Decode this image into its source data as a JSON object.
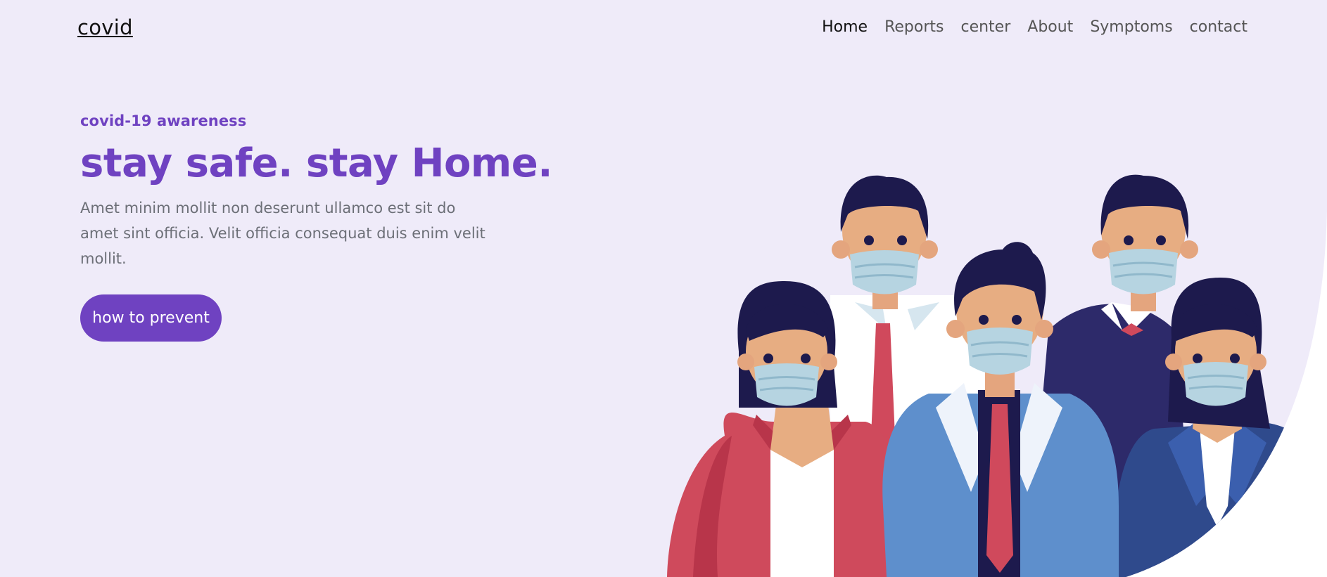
{
  "brand": {
    "name": "covid"
  },
  "nav": {
    "items": [
      {
        "label": "Home",
        "active": true
      },
      {
        "label": "Reports",
        "active": false
      },
      {
        "label": "center",
        "active": false
      },
      {
        "label": "About",
        "active": false
      },
      {
        "label": "Symptoms",
        "active": false
      },
      {
        "label": "contact",
        "active": false
      }
    ]
  },
  "hero": {
    "eyebrow": "covid-19 awareness",
    "headline": "stay safe. stay Home.",
    "lead": "Amet minim mollit non deserunt ullamco est sit do amet sint officia. Velit officia consequat duis enim velit mollit.",
    "cta_label": "how to prevent"
  },
  "colors": {
    "background": "#efebf9",
    "accent": "#6f42c1",
    "body_text": "#6c6f77",
    "nav_text": "#555555",
    "nav_active": "#111111"
  },
  "illustration": {
    "subject": "five people wearing face masks"
  }
}
